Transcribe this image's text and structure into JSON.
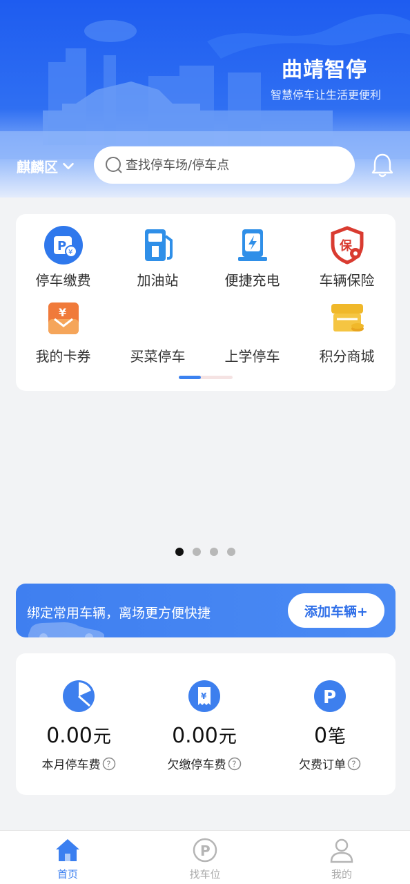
{
  "header": {
    "brand_title": "曲靖智停",
    "brand_subtitle": "智慧停车让生活更便利",
    "district": "麒麟区",
    "search_placeholder": "查找停车场/停车点"
  },
  "services": [
    {
      "label": "停车缴费",
      "icon": "parking-payment-icon",
      "color": "#2f78ec"
    },
    {
      "label": "加油站",
      "icon": "gas-station-icon",
      "color": "#2f8fe8"
    },
    {
      "label": "便捷充电",
      "icon": "charging-station-icon",
      "color": "#2f8fe8"
    },
    {
      "label": "车辆保险",
      "icon": "insurance-shield-icon",
      "color": "#d93b30"
    },
    {
      "label": "我的卡券",
      "icon": "coupon-icon",
      "color": "#f07a3a"
    },
    {
      "label": "买菜停车",
      "icon": "",
      "color": ""
    },
    {
      "label": "上学停车",
      "icon": "",
      "color": ""
    },
    {
      "label": "积分商城",
      "icon": "points-mall-icon",
      "color": "#f0b82a"
    }
  ],
  "banner": {
    "dots_total": 4,
    "active_dot": 1
  },
  "bind_car": {
    "text": "绑定常用车辆，离场更方便快捷",
    "button_label": "添加车辆+"
  },
  "stats": [
    {
      "value": "0.00",
      "unit": "元",
      "label": "本月停车费",
      "icon": "pie-chart-icon"
    },
    {
      "value": "0.00",
      "unit": "元",
      "label": "欠缴停车费",
      "icon": "receipt-yen-icon"
    },
    {
      "value": "0",
      "unit": "笔",
      "label": "欠费订单",
      "icon": "parking-p-icon"
    }
  ],
  "tabs": [
    {
      "label": "首页",
      "icon": "home-icon",
      "active": true
    },
    {
      "label": "找车位",
      "icon": "parking-search-icon",
      "active": false
    },
    {
      "label": "我的",
      "icon": "user-icon",
      "active": false
    }
  ],
  "colors": {
    "primary": "#3b7ff0",
    "header_blue": "#1e5cf0",
    "background": "#f2f3f5"
  }
}
